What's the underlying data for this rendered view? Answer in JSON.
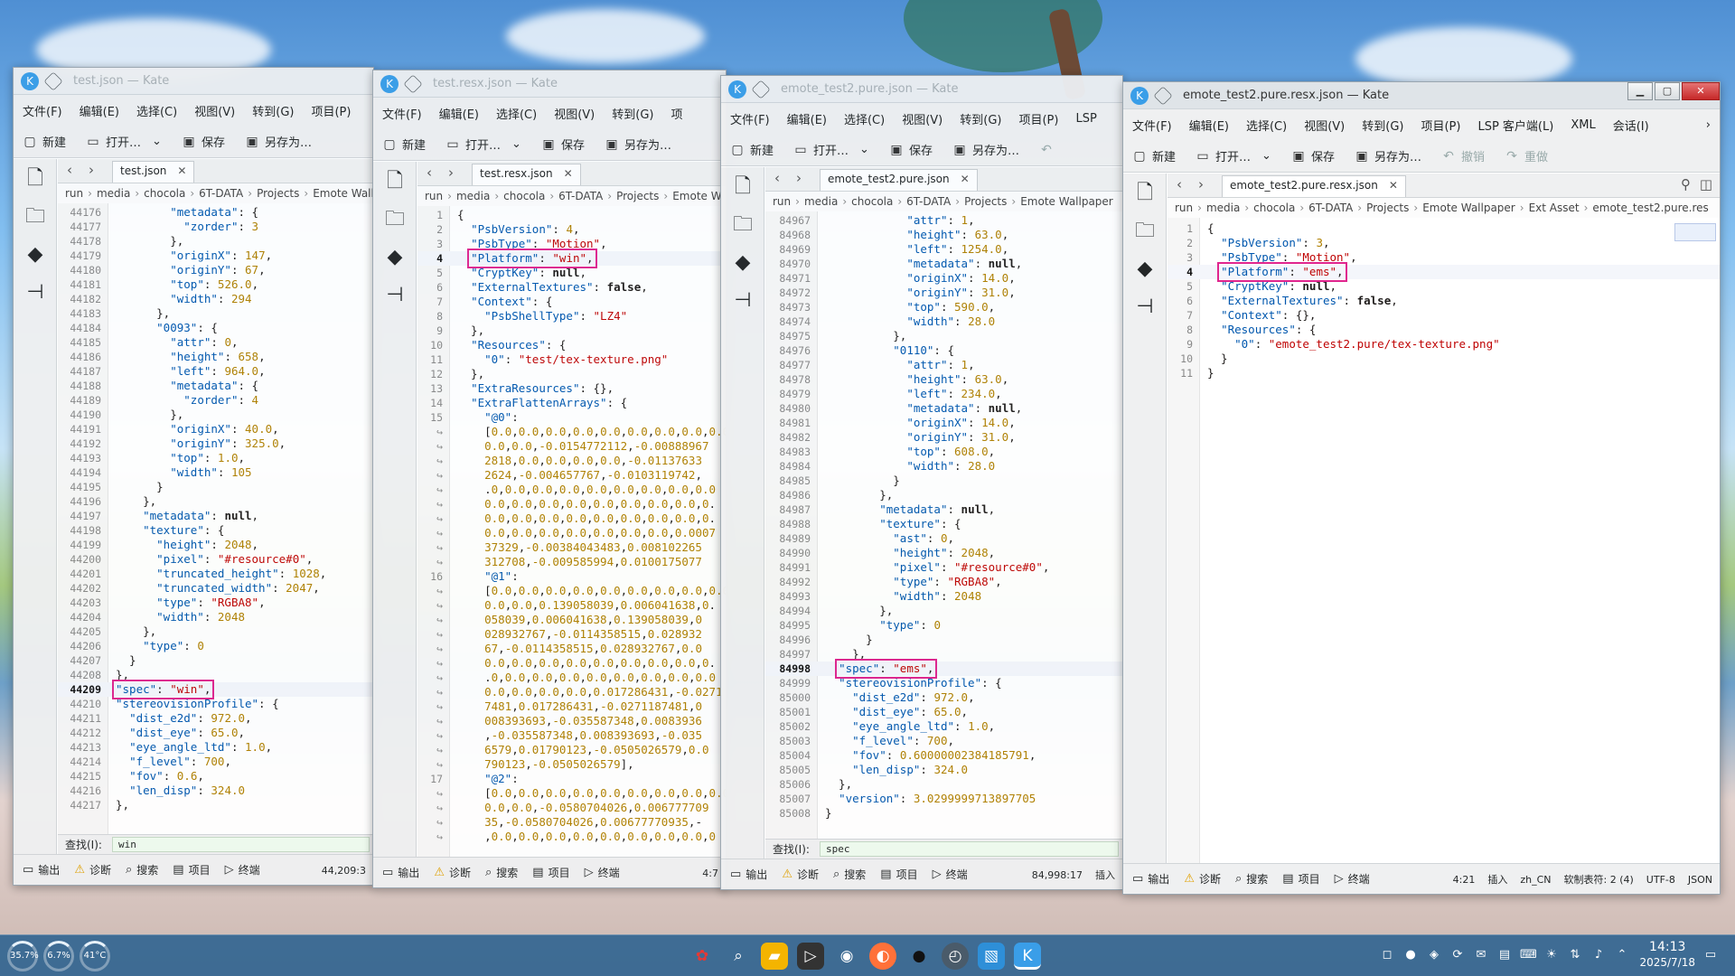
{
  "colors": {
    "highlight": "#e0258e",
    "key": "#0057ae",
    "string": "#bf0303",
    "number": "#b08000"
  },
  "menus": {
    "w1": [
      "文件(F)",
      "编辑(E)",
      "选择(C)",
      "视图(V)",
      "转到(G)",
      "项目(P)"
    ],
    "w2": [
      "文件(F)",
      "编辑(E)",
      "选择(C)",
      "视图(V)",
      "转到(G)",
      "项"
    ],
    "w3": [
      "文件(F)",
      "编辑(E)",
      "选择(C)",
      "视图(V)",
      "转到(G)",
      "项目(P)",
      "LSP"
    ],
    "w4": [
      "文件(F)",
      "编辑(E)",
      "选择(C)",
      "视图(V)",
      "转到(G)",
      "项目(P)",
      "LSP 客户端(L)",
      "XML",
      "会话(I)"
    ]
  },
  "toolbar": {
    "new": "新建",
    "open": "打开…",
    "save": "保存",
    "save_as": "另存为…",
    "undo": "撤销",
    "redo": "重做"
  },
  "status": {
    "output": "输出",
    "diagnostics": "诊断",
    "search": "搜索",
    "project": "项目",
    "terminal": "终端"
  },
  "w1": {
    "title": "test.json — Kate",
    "tab": "test.json",
    "crumbs": [
      "run",
      "media",
      "chocola",
      "6T-DATA",
      "Projects",
      "Emote Wall"
    ],
    "lines": [
      {
        "n": "44176",
        "t": "        \"metadata\": {"
      },
      {
        "n": "44177",
        "t": "          \"zorder\": 3"
      },
      {
        "n": "44178",
        "t": "        },"
      },
      {
        "n": "44179",
        "t": "        \"originX\": 147,"
      },
      {
        "n": "44180",
        "t": "        \"originY\": 67,"
      },
      {
        "n": "44181",
        "t": "        \"top\": 526.0,"
      },
      {
        "n": "44182",
        "t": "        \"width\": 294"
      },
      {
        "n": "44183",
        "t": "      },"
      },
      {
        "n": "44184",
        "t": "      \"0093\": {"
      },
      {
        "n": "44185",
        "t": "        \"attr\": 0,"
      },
      {
        "n": "44186",
        "t": "        \"height\": 658,"
      },
      {
        "n": "44187",
        "t": "        \"left\": 964.0,"
      },
      {
        "n": "44188",
        "t": "        \"metadata\": {"
      },
      {
        "n": "44189",
        "t": "          \"zorder\": 4"
      },
      {
        "n": "44190",
        "t": "        },"
      },
      {
        "n": "44191",
        "t": "        \"originX\": 40.0,"
      },
      {
        "n": "44192",
        "t": "        \"originY\": 325.0,"
      },
      {
        "n": "44193",
        "t": "        \"top\": 1.0,"
      },
      {
        "n": "44194",
        "t": "        \"width\": 105"
      },
      {
        "n": "44195",
        "t": "      }"
      },
      {
        "n": "44196",
        "t": "    },"
      },
      {
        "n": "44197",
        "t": "    \"metadata\": null,"
      },
      {
        "n": "44198",
        "t": "    \"texture\": {"
      },
      {
        "n": "44199",
        "t": "      \"height\": 2048,"
      },
      {
        "n": "44200",
        "t": "      \"pixel\": \"#resource#0\","
      },
      {
        "n": "44201",
        "t": "      \"truncated_height\": 1028,"
      },
      {
        "n": "44202",
        "t": "      \"truncated_width\": 2047,"
      },
      {
        "n": "44203",
        "t": "      \"type\": \"RGBA8\","
      },
      {
        "n": "44204",
        "t": "      \"width\": 2048"
      },
      {
        "n": "44205",
        "t": "    },"
      },
      {
        "n": "44206",
        "t": "    \"type\": 0"
      },
      {
        "n": "44207",
        "t": "  }"
      },
      {
        "n": "44208",
        "t": "},"
      },
      {
        "n": "44209",
        "t": "\"spec\": \"win\","
      },
      {
        "n": "44210",
        "t": "\"stereovisionProfile\": {"
      },
      {
        "n": "44211",
        "t": "  \"dist_e2d\": 972.0,"
      },
      {
        "n": "44212",
        "t": "  \"dist_eye\": 65.0,"
      },
      {
        "n": "44213",
        "t": "  \"eye_angle_ltd\": 1.0,"
      },
      {
        "n": "44214",
        "t": "  \"f_level\": 700,"
      },
      {
        "n": "44215",
        "t": "  \"fov\": 0.6,"
      },
      {
        "n": "44216",
        "t": "  \"len_disp\": 324.0"
      },
      {
        "n": "44217",
        "t": "},"
      }
    ],
    "find_label": "查找(I):",
    "find_value": "win",
    "position": "44,209:3"
  },
  "w2": {
    "title": "test.resx.json — Kate",
    "tab": "test.resx.json",
    "crumbs": [
      "run",
      "media",
      "chocola",
      "6T-DATA",
      "Projects",
      "Emote W"
    ],
    "lines": [
      {
        "n": "1",
        "t": "{"
      },
      {
        "n": "2",
        "t": "  \"PsbVersion\": 4,"
      },
      {
        "n": "3",
        "t": "  \"PsbType\": \"Motion\","
      },
      {
        "n": "4",
        "t": "  \"Platform\": \"win\","
      },
      {
        "n": "5",
        "t": "  \"CryptKey\": null,"
      },
      {
        "n": "6",
        "t": "  \"ExternalTextures\": false,"
      },
      {
        "n": "7",
        "t": "  \"Context\": {"
      },
      {
        "n": "8",
        "t": "    \"PsbShellType\": \"LZ4\""
      },
      {
        "n": "9",
        "t": "  },"
      },
      {
        "n": "10",
        "t": "  \"Resources\": {"
      },
      {
        "n": "11",
        "t": "    \"0\": \"test/tex-texture.png\""
      },
      {
        "n": "12",
        "t": "  },"
      },
      {
        "n": "13",
        "t": "  \"ExtraResources\": {},"
      },
      {
        "n": "14",
        "t": "  \"ExtraFlattenArrays\": {"
      },
      {
        "n": "15",
        "t": "    \"@0\":"
      },
      {
        "n": "↪",
        "t": "    [0.0,0.0,0.0,0.0,0.0,0.0,0.0,0.0,0.0"
      },
      {
        "n": "↪",
        "t": "    0.0,0.0,-0.0154772112,-0.00888967"
      },
      {
        "n": "↪",
        "t": "    2818,0.0,0.0,0.0,0.0,-0.01137633"
      },
      {
        "n": "↪",
        "t": "    2624,-0.004657767,-0.0103119742,"
      },
      {
        "n": "↪",
        "t": "    .0,0.0,0.0,0.0,0.0,0.0,0.0,0.0,0.0"
      },
      {
        "n": "↪",
        "t": "    0.0,0.0,0.0,0.0,0.0,0.0,0.0,0.0,0."
      },
      {
        "n": "↪",
        "t": "    0.0,0.0,0.0,0.0,0.0,0.0,0.0,0.0,0."
      },
      {
        "n": "↪",
        "t": "    0.0,0.0,0.0,0.0,0.0,0.0,0.0,0.0007"
      },
      {
        "n": "↪",
        "t": "    37329,-0.00384043483,0.008102265"
      },
      {
        "n": "↪",
        "t": "    312708,-0.009585994,0.0100175077"
      },
      {
        "n": "16",
        "t": "    \"@1\":"
      },
      {
        "n": "↪",
        "t": "    [0.0,0.0,0.0,0.0,0.0,0.0,0.0,0.0,0.0"
      },
      {
        "n": "↪",
        "t": "    0.0,0.0,0.139058039,0.006041638,0."
      },
      {
        "n": "↪",
        "t": "    058039,0.006041638,0.139058039,0"
      },
      {
        "n": "↪",
        "t": "    028932767,-0.0114358515,0.028932"
      },
      {
        "n": "↪",
        "t": "    67,-0.0114358515,0.028932767,0.0"
      },
      {
        "n": "↪",
        "t": "    0.0,0.0,0.0,0.0,0.0,0.0,0.0,0.0,0."
      },
      {
        "n": "↪",
        "t": "    .0,0.0,0.0,0.0,0.0,0.0,0.0,0.0,0.0"
      },
      {
        "n": "↪",
        "t": "    0.0,0.0,0.0,0.0,0.017286431,-0.0271"
      },
      {
        "n": "↪",
        "t": "    7481,0.017286431,-0.0271187481,0"
      },
      {
        "n": "↪",
        "t": "    008393693,-0.035587348,0.0083936"
      },
      {
        "n": "↪",
        "t": "    ,-0.035587348,0.008393693,-0.035"
      },
      {
        "n": "↪",
        "t": "    6579,0.01790123,-0.0505026579,0.0"
      },
      {
        "n": "↪",
        "t": "    790123,-0.0505026579],"
      },
      {
        "n": "17",
        "t": "    \"@2\":"
      },
      {
        "n": "↪",
        "t": "    [0.0,0.0,0.0,0.0,0.0,0.0,0.0,0.0,0.0"
      },
      {
        "n": "↪",
        "t": "    0.0,0.0,-0.0580704026,0.006777709"
      },
      {
        "n": "↪",
        "t": "    35,-0.0580704026,0.00677770935,-"
      },
      {
        "n": "↪",
        "t": "    ,0.0,0.0,0.0,0.0,0.0,0.0,0.0,0.0,0"
      }
    ],
    "position": "4:7"
  },
  "w3": {
    "title": "emote_test2.pure.json — Kate",
    "tab": "emote_test2.pure.json",
    "crumbs": [
      "run",
      "media",
      "chocola",
      "6T-DATA",
      "Projects",
      "Emote Wallpaper"
    ],
    "lines": [
      {
        "n": "84967",
        "t": "            \"attr\": 1,"
      },
      {
        "n": "84968",
        "t": "            \"height\": 63.0,"
      },
      {
        "n": "84969",
        "t": "            \"left\": 1254.0,"
      },
      {
        "n": "84970",
        "t": "            \"metadata\": null,"
      },
      {
        "n": "84971",
        "t": "            \"originX\": 14.0,"
      },
      {
        "n": "84972",
        "t": "            \"originY\": 31.0,"
      },
      {
        "n": "84973",
        "t": "            \"top\": 590.0,"
      },
      {
        "n": "84974",
        "t": "            \"width\": 28.0"
      },
      {
        "n": "84975",
        "t": "          },"
      },
      {
        "n": "84976",
        "t": "          \"0110\": {"
      },
      {
        "n": "84977",
        "t": "            \"attr\": 1,"
      },
      {
        "n": "84978",
        "t": "            \"height\": 63.0,"
      },
      {
        "n": "84979",
        "t": "            \"left\": 234.0,"
      },
      {
        "n": "84980",
        "t": "            \"metadata\": null,"
      },
      {
        "n": "84981",
        "t": "            \"originX\": 14.0,"
      },
      {
        "n": "84982",
        "t": "            \"originY\": 31.0,"
      },
      {
        "n": "84983",
        "t": "            \"top\": 608.0,"
      },
      {
        "n": "84984",
        "t": "            \"width\": 28.0"
      },
      {
        "n": "84985",
        "t": "          }"
      },
      {
        "n": "84986",
        "t": "        },"
      },
      {
        "n": "84987",
        "t": "        \"metadata\": null,"
      },
      {
        "n": "84988",
        "t": "        \"texture\": {"
      },
      {
        "n": "84989",
        "t": "          \"ast\": 0,"
      },
      {
        "n": "84990",
        "t": "          \"height\": 2048,"
      },
      {
        "n": "84991",
        "t": "          \"pixel\": \"#resource#0\","
      },
      {
        "n": "84992",
        "t": "          \"type\": \"RGBA8\","
      },
      {
        "n": "84993",
        "t": "          \"width\": 2048"
      },
      {
        "n": "84994",
        "t": "        },"
      },
      {
        "n": "84995",
        "t": "        \"type\": 0"
      },
      {
        "n": "84996",
        "t": "      }"
      },
      {
        "n": "84997",
        "t": "    },"
      },
      {
        "n": "84998",
        "t": "  \"spec\": \"ems\","
      },
      {
        "n": "84999",
        "t": "  \"stereovisionProfile\": {"
      },
      {
        "n": "85000",
        "t": "    \"dist_e2d\": 972.0,"
      },
      {
        "n": "85001",
        "t": "    \"dist_eye\": 65.0,"
      },
      {
        "n": "85002",
        "t": "    \"eye_angle_ltd\": 1.0,"
      },
      {
        "n": "85003",
        "t": "    \"f_level\": 700,"
      },
      {
        "n": "85004",
        "t": "    \"fov\": 0.60000002384185791,"
      },
      {
        "n": "85005",
        "t": "    \"len_disp\": 324.0"
      },
      {
        "n": "85006",
        "t": "  },"
      },
      {
        "n": "85007",
        "t": "  \"version\": 3.0299999713897705"
      },
      {
        "n": "85008",
        "t": "}"
      }
    ],
    "find_label": "查找(I):",
    "find_value": "spec",
    "position": "84,998:17",
    "mode": "插入"
  },
  "w4": {
    "title": "emote_test2.pure.resx.json — Kate",
    "tab": "emote_test2.pure.resx.json",
    "crumbs": [
      "run",
      "media",
      "chocola",
      "6T-DATA",
      "Projects",
      "Emote Wallpaper",
      "Ext Asset",
      "emote_test2.pure.res"
    ],
    "lines": [
      {
        "n": "1",
        "t": "{"
      },
      {
        "n": "2",
        "t": "  \"PsbVersion\": 3,"
      },
      {
        "n": "3",
        "t": "  \"PsbType\": \"Motion\","
      },
      {
        "n": "4",
        "t": "  \"Platform\": \"ems\","
      },
      {
        "n": "5",
        "t": "  \"CryptKey\": null,"
      },
      {
        "n": "6",
        "t": "  \"ExternalTextures\": false,"
      },
      {
        "n": "7",
        "t": "  \"Context\": {},"
      },
      {
        "n": "8",
        "t": "  \"Resources\": {"
      },
      {
        "n": "9",
        "t": "    \"0\": \"emote_test2.pure/tex-texture.png\""
      },
      {
        "n": "10",
        "t": "  }"
      },
      {
        "n": "11",
        "t": "}"
      }
    ],
    "status_right": [
      "4:21",
      "插入",
      "zh_CN",
      "软制表符: 2 (4)",
      "UTF-8",
      "JSON"
    ]
  },
  "taskbar": {
    "gauges": [
      "35.7%",
      "6.7%",
      "41°C"
    ],
    "time": "14:13",
    "date": "2025/7/18"
  }
}
